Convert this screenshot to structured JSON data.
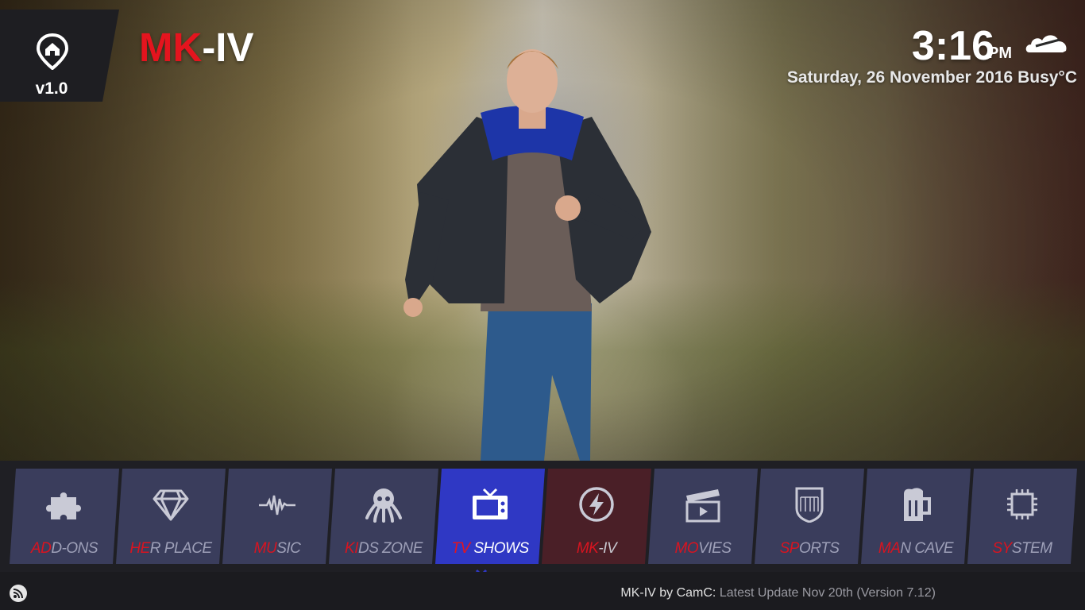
{
  "header": {
    "version": "v1.0",
    "brand_part1": "MK",
    "brand_part2": "-IV",
    "time": "3:16",
    "ampm": "PM",
    "date": "Saturday, 26 November 2016 Busy°C",
    "weather_icon": "cloud-icon"
  },
  "menu": {
    "items": [
      {
        "first": "AD",
        "rest": "D-ONS",
        "icon": "puzzle-icon"
      },
      {
        "first": "HE",
        "rest": "R PLACE",
        "icon": "diamond-icon"
      },
      {
        "first": "MU",
        "rest": "SIC",
        "icon": "waveform-icon"
      },
      {
        "first": "KI",
        "rest": "DS ZONE",
        "icon": "octopus-icon"
      },
      {
        "first": "TV",
        "rest": " SHOWS",
        "icon": "tv-icon"
      },
      {
        "first": "MK",
        "rest": "-IV",
        "icon": "lightning-icon"
      },
      {
        "first": "MO",
        "rest": "VIES",
        "icon": "clapperboard-icon"
      },
      {
        "first": "SP",
        "rest": "ORTS",
        "icon": "nfl-shield-icon"
      },
      {
        "first": "MA",
        "rest": "N CAVE",
        "icon": "beer-mug-icon"
      },
      {
        "first": "SY",
        "rest": "STEM",
        "icon": "cpu-icon"
      }
    ],
    "selected": "TV SHOWS"
  },
  "footer": {
    "text_primary": "MK-IV by CamC:",
    "text_secondary": "Latest Update Nov 20th (Version 7.12)",
    "rss_icon": "rss-icon"
  },
  "colors": {
    "accent_red": "#e4141e",
    "tile_bg": "#3a3d5c",
    "tile_active": "#2f38c4",
    "tile_special": "#4a1f27",
    "bar_bg": "#1f1f24"
  }
}
